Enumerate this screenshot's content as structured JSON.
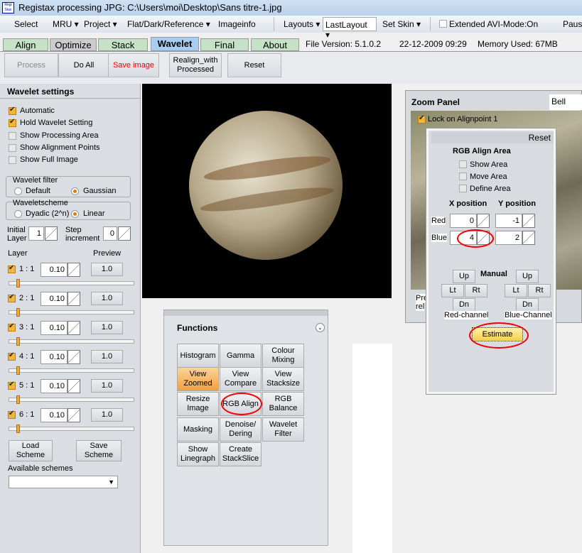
{
  "window": {
    "title": "Registax processing JPG: C:\\Users\\moi\\Desktop\\Sans titre-1.jpg",
    "logo_text": "RegiStax"
  },
  "menu": {
    "select": "Select",
    "mru": "MRU ▾",
    "project": "Project ▾",
    "flat": "Flat/Dark/Reference ▾",
    "imageinfo": "Imageinfo",
    "layouts": "Layouts ▾",
    "layout_value": "LastLayout",
    "set_skin": "Set Skin ▾",
    "extended_avi": "Extended AVI-Mode:On",
    "pause": "Pause"
  },
  "tabs": [
    {
      "label": "Align"
    },
    {
      "label": "Optimize"
    },
    {
      "label": "Stack"
    },
    {
      "label": "Wavelet"
    },
    {
      "label": "Final"
    },
    {
      "label": "About"
    }
  ],
  "status": {
    "file_version": "File Version: 5.1.0.2",
    "date": "22-12-2009 09:29",
    "memory": "Memory Used: 67MB"
  },
  "toolbar": {
    "process": "Process",
    "do_all": "Do All",
    "save_image": "Save image",
    "realign": "Realign_with Processed",
    "reset": "Reset"
  },
  "wavelet": {
    "header": "Wavelet settings",
    "options": [
      {
        "label": "Automatic",
        "checked": true
      },
      {
        "label": "Hold Wavelet Setting",
        "checked": true
      },
      {
        "label": "Show Processing Area",
        "checked": false
      },
      {
        "label": "Show Alignment Points",
        "checked": false
      },
      {
        "label": "Show Full Image",
        "checked": false
      }
    ],
    "filter_title": "Wavelet filter",
    "filter_default": "Default",
    "filter_gaussian": "Gaussian",
    "scheme_title": "Waveletscheme",
    "scheme_dyadic": "Dyadic (2^n)",
    "scheme_linear": "Linear",
    "initial_layer_label": "Initial Layer",
    "initial_layer": "1",
    "step_label": "Step increment",
    "step": "0",
    "layer_head": "Layer",
    "preview_head": "Preview",
    "layers": [
      {
        "label": "1 : 1",
        "value": "0.10",
        "preview": "1.0"
      },
      {
        "label": "2 : 1",
        "value": "0.10",
        "preview": "1.0"
      },
      {
        "label": "3 : 1",
        "value": "0.10",
        "preview": "1.0"
      },
      {
        "label": "4 : 1",
        "value": "0.10",
        "preview": "1.0"
      },
      {
        "label": "5 : 1",
        "value": "0.10",
        "preview": "1.0"
      },
      {
        "label": "6 : 1",
        "value": "0.10",
        "preview": "1.0"
      }
    ],
    "load_scheme": "Load Scheme",
    "save_scheme": "Save Scheme",
    "available_schemes": "Available schemes"
  },
  "functions": {
    "header": "Functions",
    "buttons": [
      "Histogram",
      "Gamma",
      "Colour Mixing",
      "View Zoomed",
      "View Compare",
      "View Stacksize",
      "Resize Image",
      "RGB Align",
      "RGB Balance",
      "Masking",
      "Denoise/ Dering",
      "Wavelet Filter",
      "Show Linegraph",
      "Create StackSlice"
    ]
  },
  "zoom_panel": {
    "title": "Zoom Panel",
    "filter": "Bell",
    "lock": "Lock on Alignpoint 1",
    "frag1": "Pre",
    "frag2": "rel"
  },
  "rgb_align": {
    "reset": "Reset",
    "title": "RGB Align Area",
    "show_area": "Show Area",
    "move_area": "Move Area",
    "define_area": "Define Area",
    "x_head": "X position",
    "y_head": "Y position",
    "red": "Red",
    "blue": "Blue",
    "red_x": "0",
    "red_y": "-1",
    "blue_x": "4",
    "blue_y": "2",
    "manual": "Manual",
    "up": "Up",
    "lt": "Lt",
    "rt": "Rt",
    "dn": "Dn",
    "red_channel": "Red-channel",
    "blue_channel": "Blue-Channel",
    "estimate": "Estimate"
  },
  "colors": {
    "active_tab": "#a9cdf0",
    "tab": "#c6e2c6",
    "highlight": "#f2b540",
    "annotation": "#e00000",
    "save": "#e00000"
  }
}
